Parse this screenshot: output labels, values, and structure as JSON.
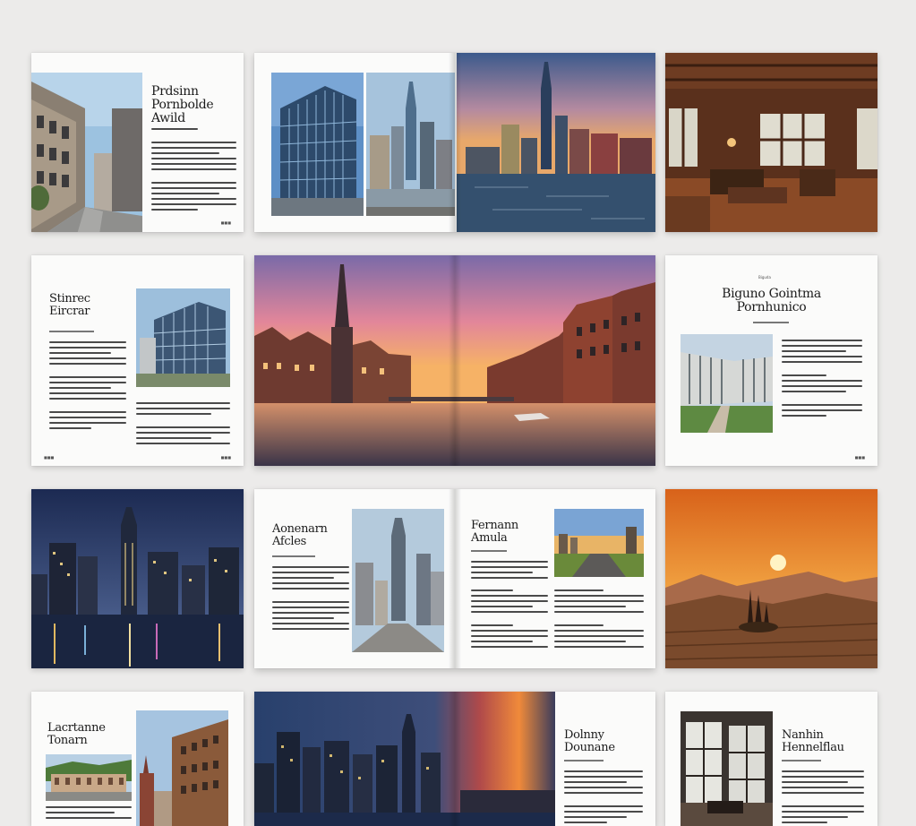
{
  "row1": {
    "titles": {
      "p1": "Prdsinn\nPornbolde\nAwild"
    },
    "page_numbers": {
      "p1": "■■■"
    }
  },
  "row2": {
    "titles": {
      "p1": "Stinrec\nEircrar",
      "p3": "Biguno Gointma\nPornhunico"
    },
    "small": {
      "p3": "Biguda"
    },
    "page_numbers": {
      "p1": "■■■",
      "p3": "■■■"
    }
  },
  "row3": {
    "titles": {
      "left": "Aonenarn\nAfcles",
      "right": "Fernann\nAmula"
    }
  },
  "row4": {
    "titles": {
      "p1": "Lacrtanne\nTonarn",
      "spread": "Dolnny\nDounane",
      "p3": "Nanhin\nHennelflau"
    }
  },
  "colors": {
    "background": "#ecebea",
    "paper": "#fbfbfa",
    "ink": "#1b1b1b"
  }
}
